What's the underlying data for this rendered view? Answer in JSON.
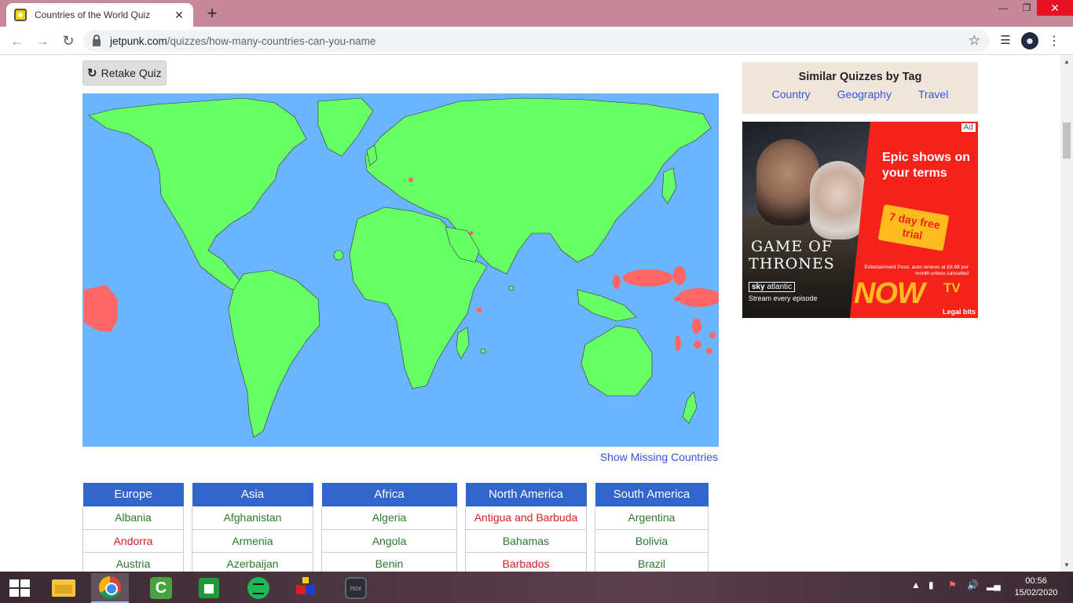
{
  "browser": {
    "tab_title": "Countries of the World Quiz",
    "tab_close": "✕",
    "new_tab": "+",
    "url_domain": "jetpunk.com",
    "url_path": "/quizzes/how-many-countries-can-you-name",
    "window_min": "—",
    "window_max": "❐",
    "window_close": "✕"
  },
  "quiz": {
    "retake_label": "Retake Quiz",
    "show_missing_label": "Show Missing Countries"
  },
  "sidebar": {
    "title": "Similar Quizzes by Tag",
    "tags": [
      "Country",
      "Geography",
      "Travel"
    ]
  },
  "ad": {
    "label": "Ad",
    "headline": "Epic shows on your terms",
    "ticket": "7 day free trial",
    "show_title": "GAME OF THRONES",
    "channel_sky": "sky",
    "channel_name": "atlantic",
    "stream_text": "Stream every episode",
    "fine_print": "Entertainment Pass: auto-renews at £8.99 per month unless cancelled",
    "brand": "NOW",
    "brand_tv": "TV",
    "legal": "Legal bits"
  },
  "colors": {
    "map_sea": "#6bb5ff",
    "map_found": "#66ff66",
    "map_missing": "#ff6666",
    "table_header": "#3366cc",
    "found_text": "#2b7a2b",
    "missing_text": "#d92020",
    "link": "#3355dd"
  },
  "continents": [
    {
      "name": "Europe",
      "rows": [
        {
          "country": "Albania",
          "status": "found"
        },
        {
          "country": "Andorra",
          "status": "missing"
        },
        {
          "country": "Austria",
          "status": "found"
        }
      ]
    },
    {
      "name": "Asia",
      "rows": [
        {
          "country": "Afghanistan",
          "status": "found"
        },
        {
          "country": "Armenia",
          "status": "found"
        },
        {
          "country": "Azerbaijan",
          "status": "found"
        }
      ]
    },
    {
      "name": "Africa",
      "rows": [
        {
          "country": "Algeria",
          "status": "found"
        },
        {
          "country": "Angola",
          "status": "found"
        },
        {
          "country": "Benin",
          "status": "found"
        }
      ]
    },
    {
      "name": "North America",
      "rows": [
        {
          "country": "Antigua and Barbuda",
          "status": "missing"
        },
        {
          "country": "Bahamas",
          "status": "found"
        },
        {
          "country": "Barbados",
          "status": "missing"
        }
      ]
    },
    {
      "name": "South America",
      "rows": [
        {
          "country": "Argentina",
          "status": "found"
        },
        {
          "country": "Bolivia",
          "status": "found"
        },
        {
          "country": "Brazil",
          "status": "found"
        }
      ]
    }
  ],
  "taskbar": {
    "apps": [
      "File Explorer",
      "Google Chrome",
      "Camtasia",
      "Microsoft Store",
      "Spotify",
      "Blocks app",
      "NoxPlayer"
    ],
    "time": "00:56",
    "date": "15/02/2020"
  }
}
